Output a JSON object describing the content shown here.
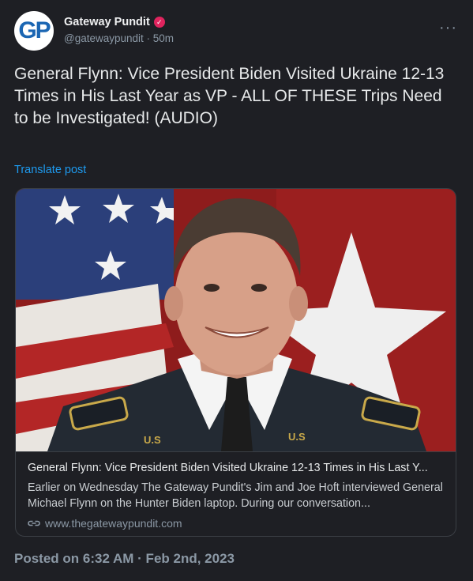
{
  "author": {
    "avatar_text": "GP",
    "display_name": "Gateway Pundit",
    "verified_mark": "✓",
    "handle_line": "@gatewaypundit · 50m",
    "verified_color": "#e0245e"
  },
  "menu": {
    "more_label": "···"
  },
  "post": {
    "text": "General Flynn: Vice President Biden Visited Ukraine 12-13 Times in His Last Year as VP - ALL OF THESE Trips Need to be Investigated! (AUDIO)",
    "translate_label": "Translate post"
  },
  "card": {
    "image_icon": "portrait-photo",
    "title": "General Flynn: Vice President Biden Visited Ukraine 12-13 Times in His Last Y...",
    "description": "Earlier on Wednesday The Gateway Pundit's Jim and Joe Hoft interviewed General Michael Flynn on the Hunter Biden laptop. During our conversation...",
    "domain": "www.thegatewaypundit.com"
  },
  "footer": {
    "posted_at": "Posted on 6:32 AM · Feb 2nd, 2023"
  },
  "colors": {
    "background": "#1e1f24",
    "link": "#1d9bf0",
    "muted": "#8b98a5"
  }
}
